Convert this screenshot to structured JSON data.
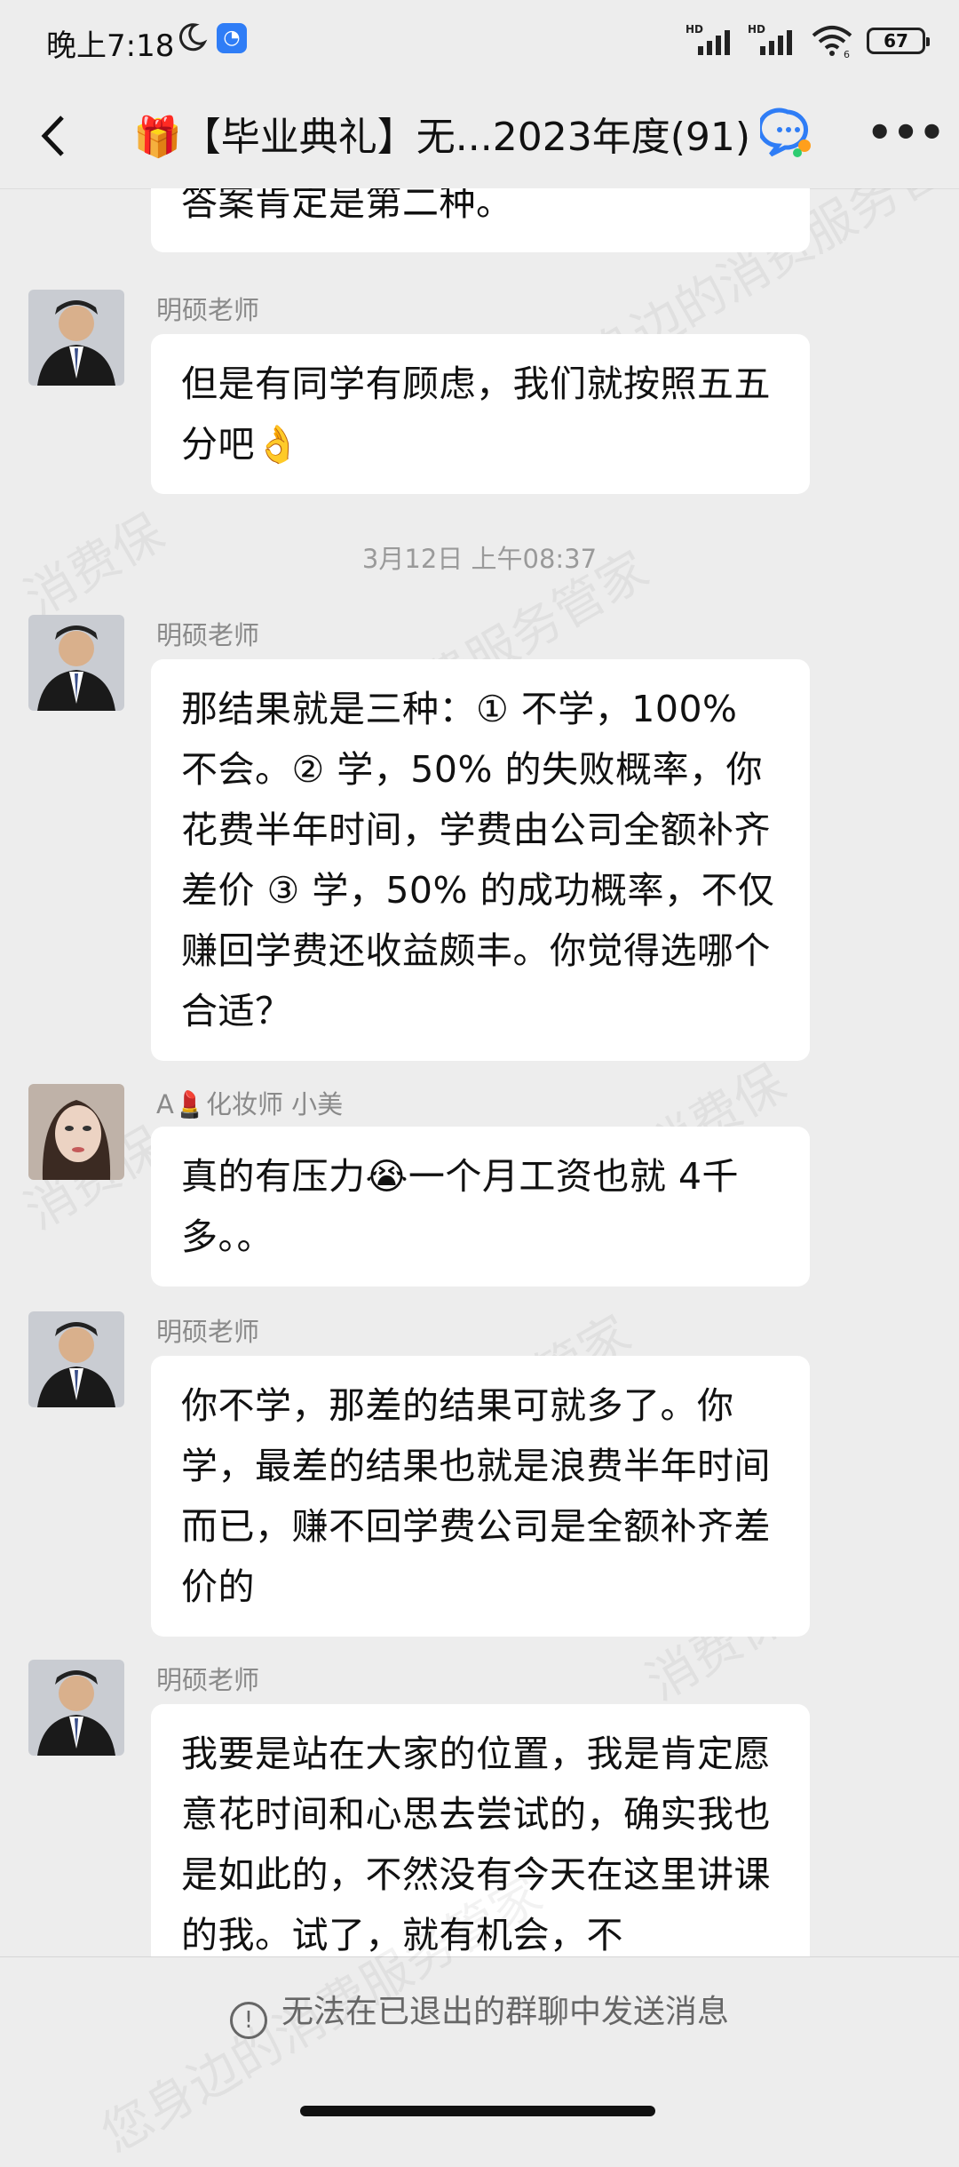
{
  "status_bar": {
    "time": "晚上7:18",
    "signal1": "HD",
    "signal2": "HD",
    "wifi_sub": "6",
    "battery": "67"
  },
  "header": {
    "title": "【毕业典礼】无...2023年度(91)",
    "gift": "🎁"
  },
  "messages": [
    {
      "text": "答案肯定是第二种。"
    },
    {
      "sender": "明硕老师",
      "text": "但是有同学有顾虑，我们就按照五五分吧👌"
    },
    {
      "sender": "明硕老师",
      "text": "那结果就是三种：① 不学，100% 不会。② 学，50% 的失败概率，你花费半年时间，学费由公司全额补齐差价 ③ 学，50% 的成功概率，不仅赚回学费还收益颇丰。你觉得选哪个合适？"
    },
    {
      "sender": "A💄化妆师 小美",
      "text": "真的有压力😭一个月工资也就 4千多。。"
    },
    {
      "sender": "明硕老师",
      "text": "你不学，那差的结果可就多了。你学，最差的结果也就是浪费半年时间而已，赚不回学费公司是全额补齐差价的"
    },
    {
      "sender": "明硕老师",
      "text": "我要是站在大家的位置，我是肯定愿意花时间和心思去尝试的，确实我也是如此的，不然没有今天在这里讲课的我。试了，就有机会，不"
    }
  ],
  "time_separator": "3月12日 上午08:37",
  "bottom": {
    "notice": "无法在已退出的群聊中发送消息",
    "notice_icon": "!"
  },
  "watermark": [
    "消费保",
    "您身边的消费服务管家"
  ]
}
